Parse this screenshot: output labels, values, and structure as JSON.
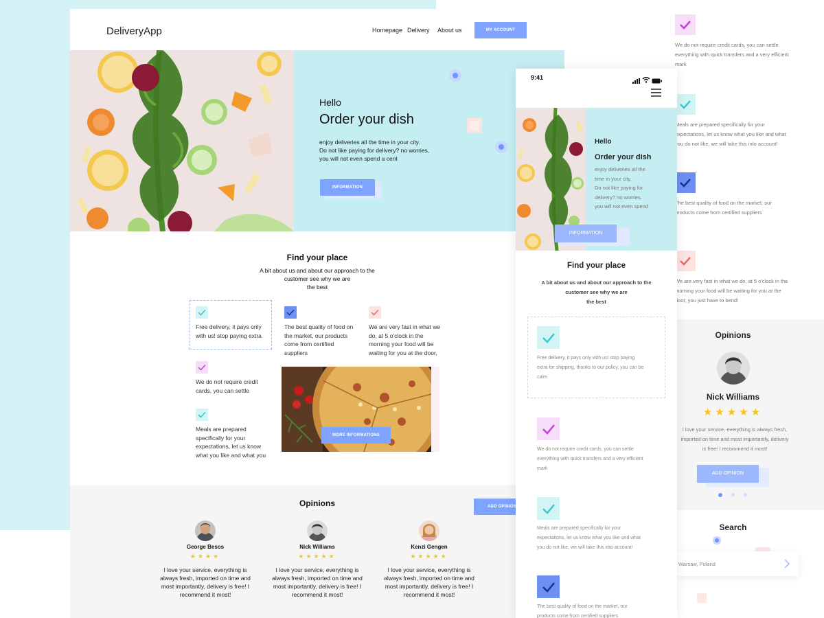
{
  "desktop": {
    "logo": "DeliveryApp",
    "nav": [
      "Homepage",
      "Delivery",
      "About us"
    ],
    "account_button": "MY ACCOUNT",
    "hero": {
      "hello": "Hello",
      "title": "Order your dish",
      "desc": [
        "enjoy deliveries all the time in your city.",
        "Do not like paying for delivery? no worries,",
        "you will not even spend a cent"
      ],
      "button": "INFORMATION"
    },
    "find": {
      "title": "Find your place",
      "subtitle": [
        "A bit about us and about our approach to the",
        "customer see why we are",
        "the best"
      ],
      "features": [
        {
          "text": [
            "Free delivery, it pays only",
            "with us! stop paying extra"
          ],
          "color": "#5ad8d8",
          "bg": "#d3f4f4"
        },
        {
          "text": [
            "The best quality of food on",
            "the market, our products",
            "come from certified",
            "suppliers"
          ],
          "color": "#2d4fd9",
          "bg": "#6d8ff0"
        },
        {
          "text": [
            "We are very fast in what we",
            "do, at 5 o'clock in the",
            "morning your food will be",
            "waiting for you at the door,"
          ],
          "color": "#e86a6a",
          "bg": "#fde2e2"
        },
        {
          "text": [
            "We do not require credit",
            "cards, you can settle"
          ],
          "color": "#c43fd6",
          "bg": "#f6ddf8"
        },
        {
          "text": [
            "Meals are prepared",
            "specifically for your",
            "expectations, let us know",
            "what you like and what you"
          ],
          "color": "#4ec4cc",
          "bg": "#d3f4f4"
        }
      ],
      "more_button": "MORE INFORMATIONS"
    },
    "opinions": {
      "title": "Opinions",
      "add_button": "ADD OPINION",
      "items": [
        {
          "name": "George Besos",
          "stars": "★★★★",
          "text": [
            "I love your service, everything is",
            "always fresh, imported on time and",
            "most importantly, delivery is free! I",
            "recommend it most!"
          ]
        },
        {
          "name": "Nick Williams",
          "stars": "★★★★★",
          "text": [
            "I love your service, everything is",
            "always fresh, imported on time and",
            "most importantly, delivery is free! I",
            "recommend it most!"
          ]
        },
        {
          "name": "Kenzi Gengen",
          "stars": "★★★★★",
          "text": [
            "I love your service, everything is",
            "always fresh, imported on time and",
            "most importantly, delivery is free! I",
            "recommend it most!"
          ]
        }
      ]
    }
  },
  "mobile": {
    "time": "9:41",
    "hero": {
      "hello": "Hello",
      "title": "Order your dish",
      "desc": [
        "enjoy deliveries all the",
        "time in your city.",
        "Do not like paying for",
        "delivery? no worries,",
        "you will not even spend"
      ],
      "button": "INFORMATION"
    },
    "find": {
      "title": "Find your place",
      "subtitle": [
        "A bit about us and about our approach to the",
        "customer see why we are",
        "the best"
      ]
    },
    "features": [
      {
        "text": [
          "Free delivery, it pays only with us! stop paying",
          "extra for shipping, thanks to our policy, you can be",
          "calm"
        ],
        "color": "#3cc7cf",
        "bg": "#d3f4f4"
      },
      {
        "text": [
          "We do not require credit cards, you can settle",
          "everything with quick transfers and a very efficient",
          "mark"
        ],
        "color": "#c43fd6",
        "bg": "#f6ddf8"
      },
      {
        "text": [
          "Meals are prepared specifically for your",
          "expectations, let us know what you like and what",
          "you do not like, we will take this into account!"
        ],
        "color": "#3cc7cf",
        "bg": "#d3f4f4"
      },
      {
        "text": [
          "The best quality of food on the market, our",
          "products come from certified suppliers"
        ],
        "color": "#2d4fd9",
        "bg": "#6d8ff0"
      }
    ]
  },
  "right": {
    "features": [
      {
        "text": [
          "We do not require credit cards, you can settle",
          "everything with quick transfers and a very efficient",
          "mark"
        ],
        "color": "#c43fd6",
        "bg": "#f6ddf8"
      },
      {
        "text": [
          "Meals are prepared specifically for your",
          "expectations, let us know what you like and what",
          "you do not like, we will take this into account!"
        ],
        "color": "#3cc7cf",
        "bg": "#d3f4f4"
      },
      {
        "text": [
          "The best quality of food on the market, our",
          "products come from certified suppliers"
        ],
        "color": "#2d4fd9",
        "bg": "#6d8ff0"
      },
      {
        "text": [
          "We are very fast in what we do, at 5 o'clock in the",
          "morning your food will be waiting for you at the",
          "door, you just have to bend!"
        ],
        "color": "#e86a6a",
        "bg": "#fde2e2"
      }
    ],
    "opinions": {
      "title": "Opinions",
      "name": "Nick Williams",
      "stars": "★★★★★",
      "text": [
        "I love your service, everything is always fresh,",
        "imported on time and most importantly, delivery",
        "is free! I recommend it most!"
      ],
      "button": "ADD OPINION"
    },
    "search": {
      "title": "Search",
      "value": "Warsaw, Poland"
    }
  },
  "colors": {
    "accent": "#7ea4ff",
    "hero_bg": "#c5eef2",
    "page_bg": "#d4f2f6",
    "star": "#f5c518"
  }
}
